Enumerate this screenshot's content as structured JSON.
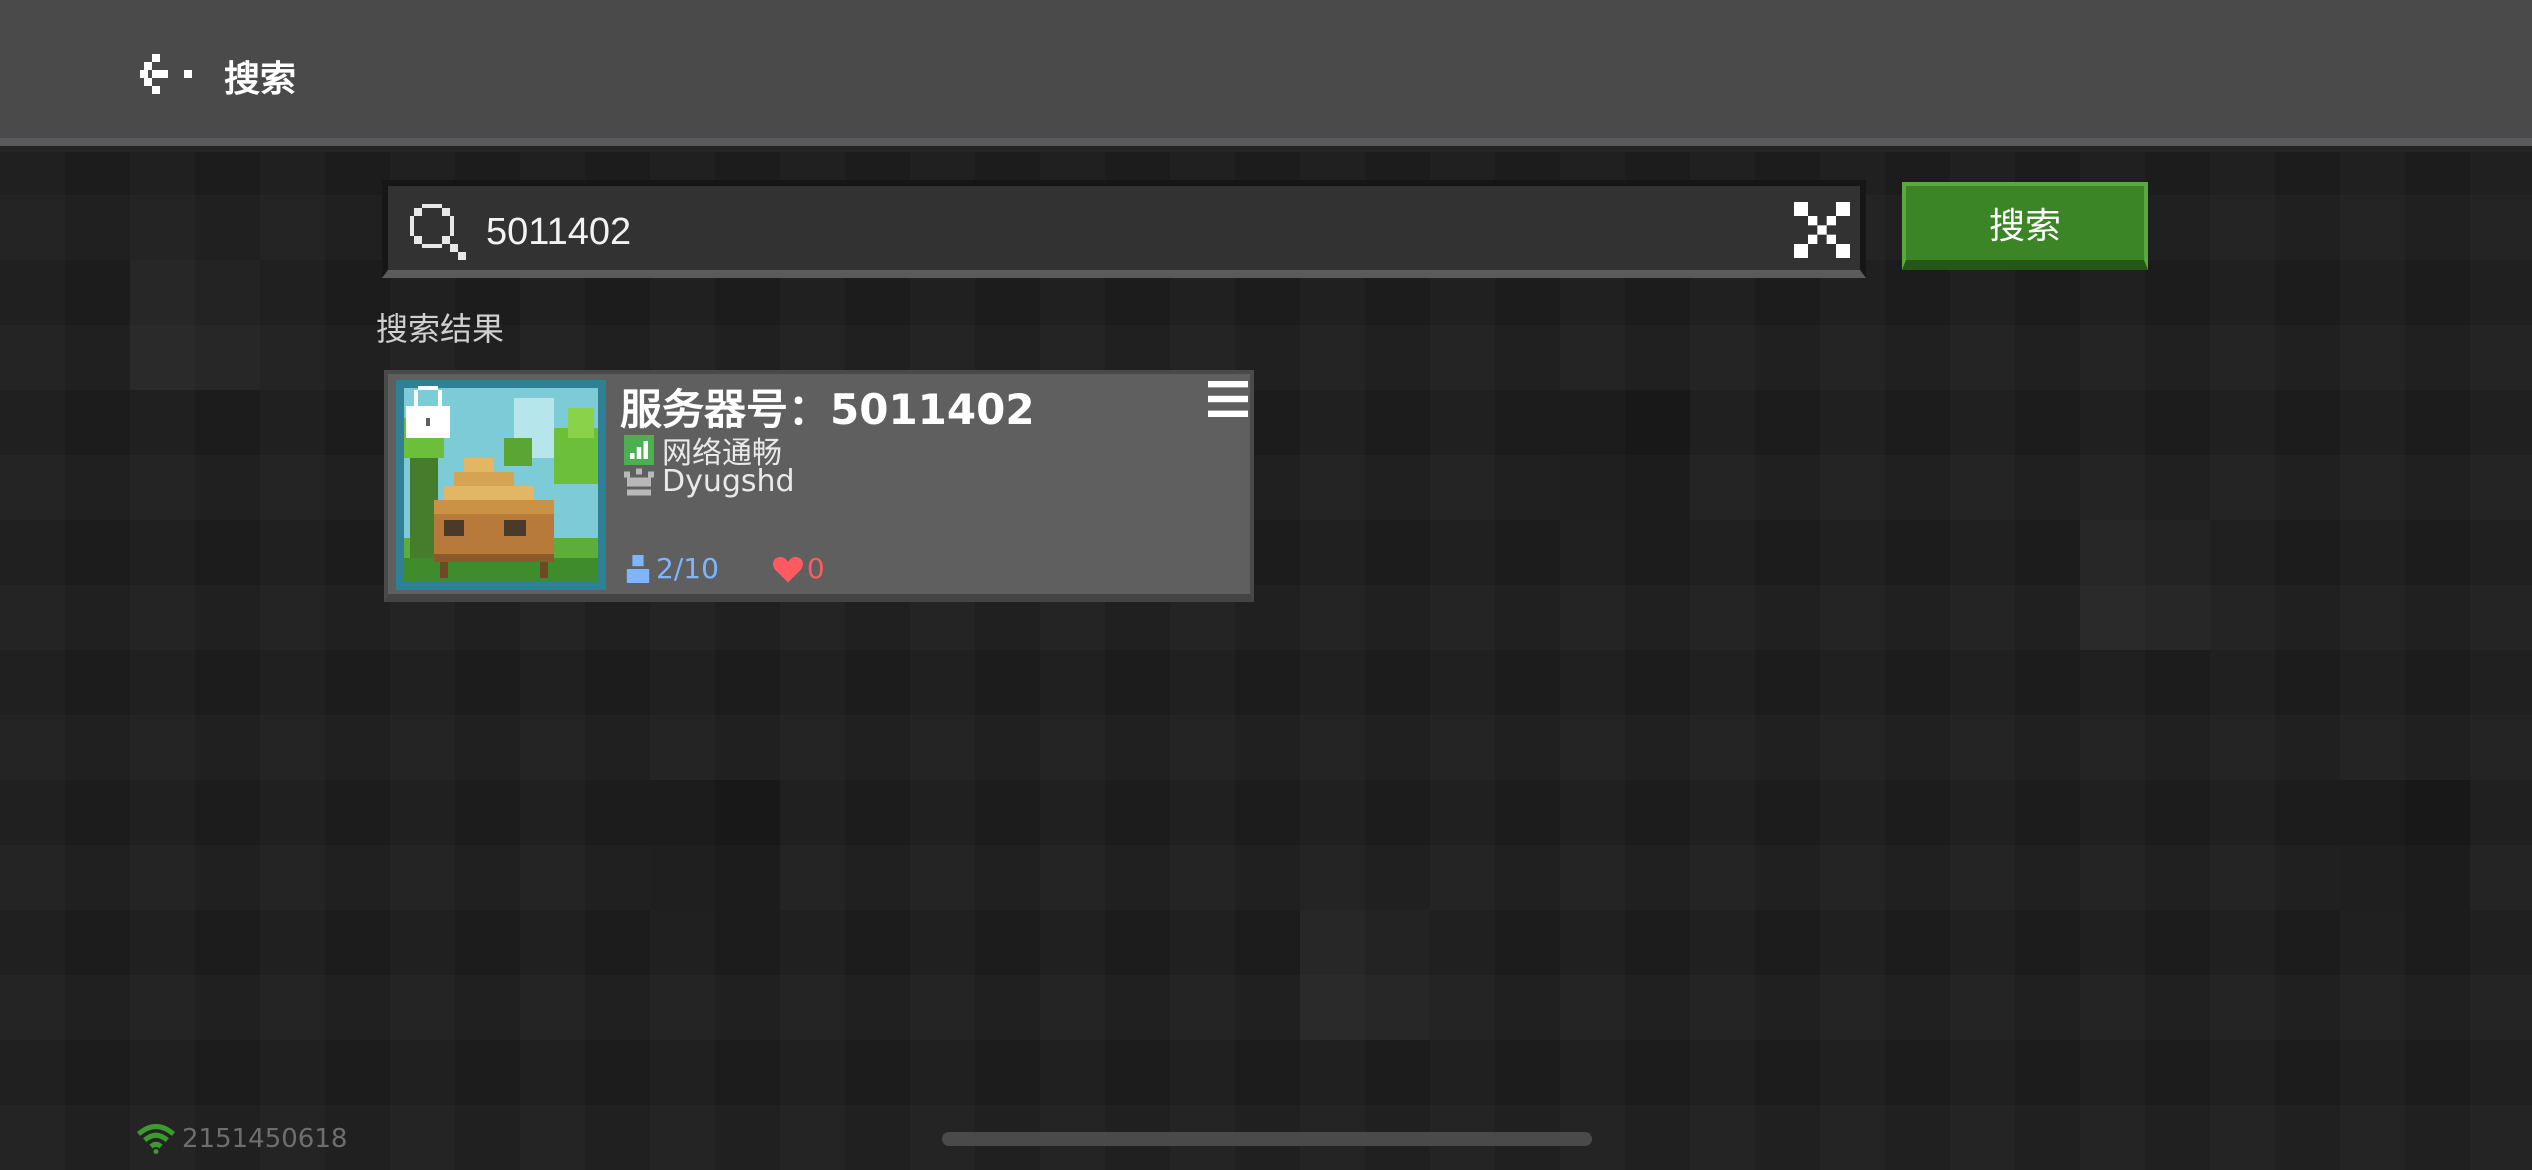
{
  "header": {
    "title": "搜索"
  },
  "search": {
    "query": "5011402",
    "button_label": "搜索"
  },
  "results": {
    "label": "搜索结果",
    "items": [
      {
        "title": "服务器号：5011402",
        "network_status": "网络通畅",
        "owner": "Dyugshd",
        "players": "2/10",
        "likes": "0",
        "locked": true
      }
    ]
  },
  "footer": {
    "user_id": "2151450618"
  },
  "colors": {
    "accent_green": "#3c8527",
    "header_bg": "#4a4a4b",
    "card_bg": "#5f5f60",
    "players_blue": "#7fb4ff",
    "likes_red": "#ff5a5f",
    "signal_green": "#4caf50"
  }
}
